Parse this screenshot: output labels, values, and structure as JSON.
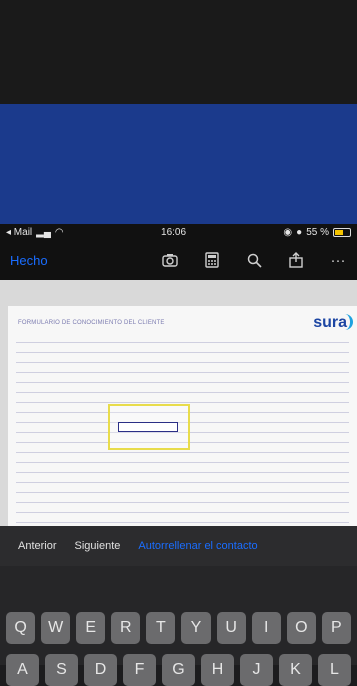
{
  "status_bar": {
    "carrier": "◂ Mail",
    "time": "16:06",
    "battery": "55 %"
  },
  "toolbar": {
    "done_label": "Hecho",
    "icons": [
      "camera-icon",
      "calculator-icon",
      "search-icon",
      "share-icon",
      "more-icon"
    ]
  },
  "document": {
    "title": "FORMULARIO DE CONOCIMIENTO DEL CLIENTE",
    "logo": "sura"
  },
  "navigation": {
    "previous_label": "Anterior",
    "next_label": "Siguiente",
    "autofill_label": "Autorrellenar el contacto"
  },
  "keyboard": {
    "row1": [
      "Q",
      "W",
      "E",
      "R",
      "T",
      "Y",
      "U",
      "I",
      "O",
      "P"
    ],
    "row2": [
      "A",
      "S",
      "D",
      "F",
      "G",
      "H",
      "J",
      "K",
      "L"
    ]
  },
  "colors": {
    "accent": "#1a6dff",
    "brand_band": "#1b3a8c",
    "highlight": "#e8dc4b"
  },
  "battery_level": 0.55
}
